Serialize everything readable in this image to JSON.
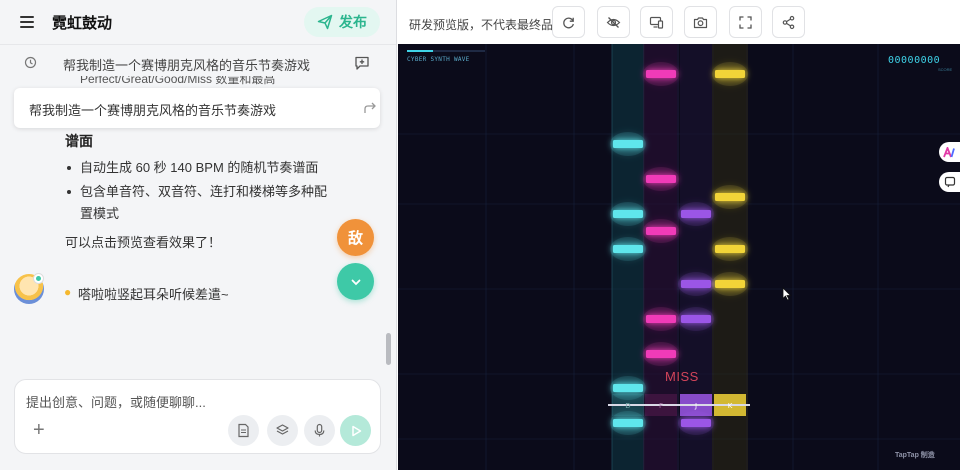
{
  "app": {
    "title": "霓虹鼓动",
    "publish_label": "发布"
  },
  "topic": {
    "text": "帮我制造一个赛博朋克风格的音乐节奏游戏"
  },
  "chat": {
    "cut_text": "Perfect/Great/Good/Miss 数量和最高",
    "floating_prompt": "帮我制造一个赛博朋克风格的音乐节奏游戏",
    "heading": "谱面",
    "bullets": [
      "自动生成 60 秒 140 BPM 的随机节奏谱面",
      "包含单音符、双音符、连打和楼梯等多种配置模式"
    ],
    "footer": "可以点击预览查看效果了！",
    "bug_label": "敌",
    "status_text": "嗒啦啦竖起耳朵听候差遣~"
  },
  "composer": {
    "placeholder": "提出创意、问题，或随便聊聊..."
  },
  "preview": {
    "note": "研发预览版，不代表最终品质"
  },
  "game": {
    "mode_label": "CYBER SYNTH WAVE",
    "score": "00000000",
    "score_label": "SCORE",
    "judge": "MISS",
    "watermark": "TapTap 制造",
    "key_labels": [
      "D",
      "F",
      "J",
      "K"
    ],
    "colors": {
      "cyan": "#5ee6ec",
      "magenta": "#f03ab8",
      "purple": "#9b57e6",
      "yellow": "#f2d437",
      "miss": "#d2445a",
      "background": "#0b0b1a"
    }
  }
}
